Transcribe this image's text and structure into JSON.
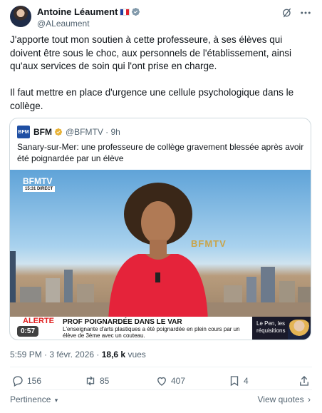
{
  "author": {
    "name": "Antoine Léaument",
    "handle": "@ALeaument"
  },
  "tweet": {
    "paragraphs": [
      "J'apporte tout mon soutien à cette professeure, à ses élèves qui doivent être sous le choc, aux personnels de l'établissement, ainsi qu'aux services de soin qui l'ont prise en charge.",
      "Il faut mettre en place d'urgence une cellule psychologique dans le collège."
    ]
  },
  "quote": {
    "logo_text": "BFM",
    "name": "BFM",
    "meta": "@BFMTV · 9h",
    "text": "Sanary-sur-Mer: une professeure de collège gravement blessée après avoir été poignardée par un élève",
    "video": {
      "channel_logo": "BFMTV",
      "live_time": "15:31 DIRECT",
      "background_brand": "BFMTV",
      "alert_label": "ALERTE",
      "banner_title": "PROF POIGNARDÉE DANS LE VAR",
      "banner_sub": "L'enseignante d'arts plastiques a été poignardée en plein cours par un élève de 3ème avec un couteau.",
      "side_text": "Le Pen, les réquisitions",
      "duration": "0:57"
    }
  },
  "timestamp": {
    "time": "5:59 PM · 3 févr. 2026 · ",
    "views_count": "18,6 k",
    "views_label": " vues"
  },
  "actions": {
    "replies": "156",
    "reposts": "85",
    "likes": "407",
    "bookmarks": "4"
  },
  "footer": {
    "left": "Pertinence",
    "right": "View quotes"
  },
  "colors": {
    "accent": "#1d9bf0",
    "muted": "#536471",
    "border": "#cfd9de",
    "verified_gold": "#e8b339"
  },
  "icons": [
    "grok-icon",
    "more-icon",
    "verified-icon",
    "reply-icon",
    "repost-icon",
    "like-icon",
    "bookmark-icon",
    "share-icon",
    "chevron-down-icon",
    "chevron-right-icon"
  ]
}
